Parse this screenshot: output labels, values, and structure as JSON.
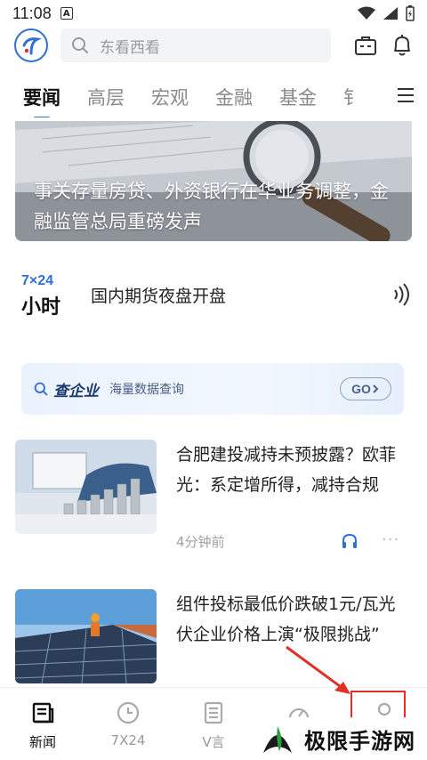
{
  "status_bar": {
    "time": "11:08",
    "badge": "A"
  },
  "search": {
    "placeholder": "东看西看"
  },
  "tabs": [
    {
      "label": "要闻",
      "active": true
    },
    {
      "label": "高层",
      "active": false
    },
    {
      "label": "宏观",
      "active": false
    },
    {
      "label": "金融",
      "active": false
    },
    {
      "label": "基金",
      "active": false
    },
    {
      "label": "钅",
      "active": false
    }
  ],
  "banner": {
    "title": "事关存量房贷、外资银行在华业务调整，金融监管总局重磅发声"
  },
  "flash": {
    "logo_top": "7×24",
    "logo_bottom": "小时",
    "text": "国内期货夜盘开盘"
  },
  "company_search": {
    "title": "查企业",
    "subtitle": "海量数据查询",
    "button": "GO"
  },
  "articles": [
    {
      "title": "合肥建投减持未预披露？欧菲光：系定增所得，减持合规",
      "time": "4分钟前"
    },
    {
      "title": "组件投标最低价跌破1元/瓦光伏企业价格上演“极限挑战”",
      "time": ""
    }
  ],
  "bottom_nav": [
    {
      "label": "新闻",
      "icon": "newspaper-icon",
      "active": true
    },
    {
      "label": "7X24",
      "icon": "clock-icon",
      "active": false
    },
    {
      "label": "V言",
      "icon": "document-icon",
      "active": false
    },
    {
      "label": "",
      "icon": "gauge-icon",
      "active": false
    },
    {
      "label": "",
      "icon": "person-icon",
      "active": false
    }
  ],
  "watermark": {
    "text": "极限手游网"
  },
  "colors": {
    "accent": "#2f6fd6",
    "highlight": "#e0302a"
  }
}
